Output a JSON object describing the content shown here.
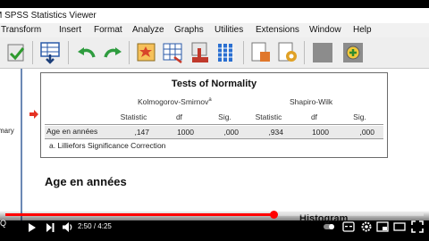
{
  "window": {
    "title": "M SPSS Statistics Viewer"
  },
  "menu": [
    {
      "label": "Transform"
    },
    {
      "label": "Insert"
    },
    {
      "label": "Format"
    },
    {
      "label": "Analyze"
    },
    {
      "label": "Graphs"
    },
    {
      "label": "Utilities"
    },
    {
      "label": "Extensions"
    },
    {
      "label": "Window"
    },
    {
      "label": "Help"
    }
  ],
  "toolbar_icons": [
    "recall-dialog-icon",
    "goto-data-icon",
    "undo-icon",
    "redo-icon",
    "goto-case-icon",
    "goto-variable-icon",
    "variables-icon",
    "create-chart-icon",
    "export-icon",
    "insert-output-icon",
    "insert-title-icon",
    "show-all-icon",
    "add-icon"
  ],
  "left_pane": {
    "fragment": "mary"
  },
  "table": {
    "title": "Tests of Normality",
    "groups": [
      {
        "label": "Kolmogorov-Smirnov",
        "sup": "a"
      },
      {
        "label": "Shapiro-Wilk",
        "sup": ""
      }
    ],
    "columns": [
      "Statistic",
      "df",
      "Sig.",
      "Statistic",
      "df",
      "Sig."
    ],
    "row_label": "Age en années",
    "row_values": [
      ",147",
      "1000",
      ",000",
      ",934",
      "1000",
      ",000"
    ],
    "footnote": "a. Lilliefors Significance Correction"
  },
  "section_heading": "Age en années",
  "overlay_heading": "Histogram",
  "video": {
    "current_time": "2:50",
    "separator": "/",
    "duration": "4:25",
    "progress_fraction": 0.642,
    "left_fragment": "Q"
  },
  "colors": {
    "accent_red": "#ff0000",
    "pane_border": "#6b88b5"
  }
}
